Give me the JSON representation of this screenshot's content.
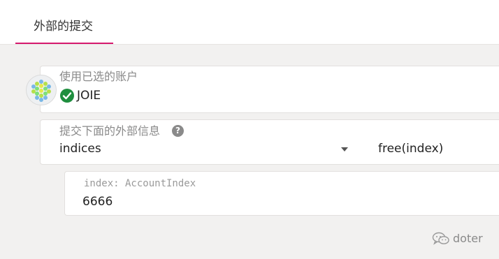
{
  "tabs": [
    {
      "label": "外部的提交"
    }
  ],
  "account": {
    "label": "使用已选的账户",
    "name": "JOIE",
    "icon": "check-circle-icon"
  },
  "extrinsic": {
    "label": "提交下面的外部信息",
    "help_icon": "help-icon",
    "module": "indices",
    "method": "free(index)"
  },
  "param": {
    "label": "index: AccountIndex",
    "value": "6666"
  },
  "watermark": {
    "text": "doter",
    "icon": "wechat-icon"
  },
  "colors": {
    "accent": "#d6196e",
    "success": "#1e8e3e"
  }
}
